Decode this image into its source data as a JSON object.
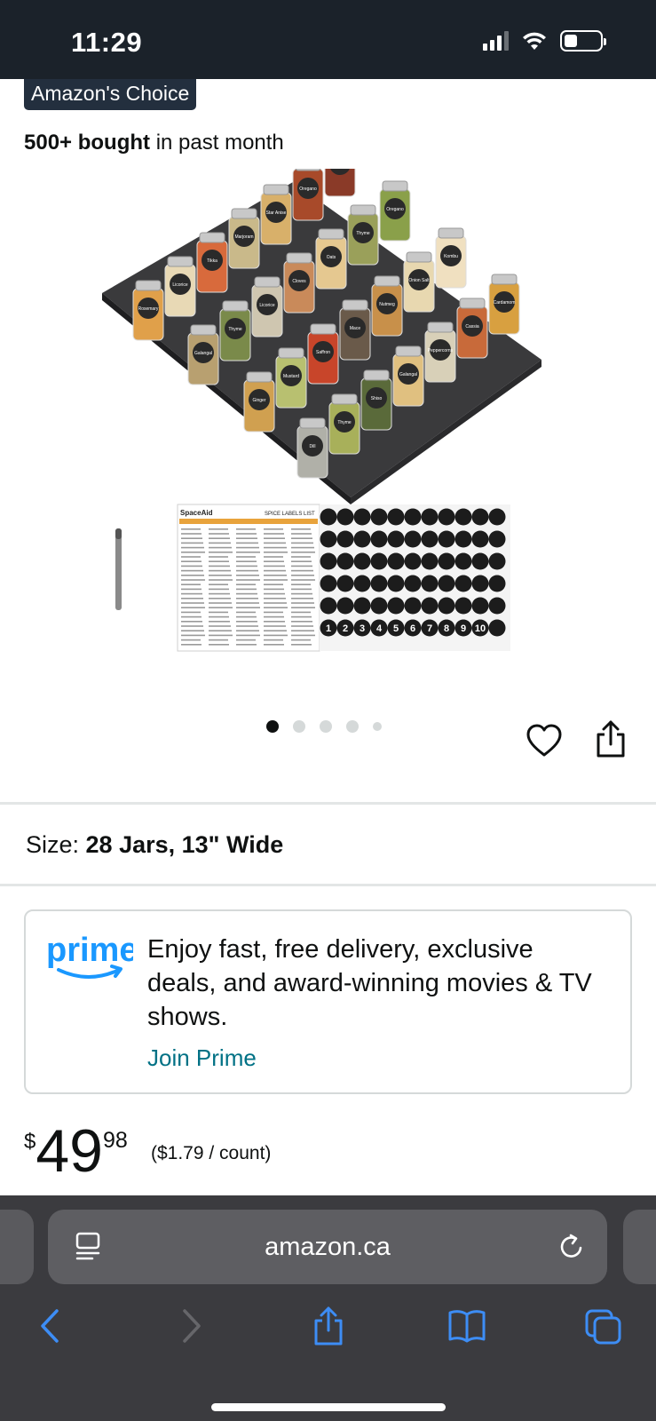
{
  "status_bar": {
    "time": "11:29"
  },
  "badge": {
    "label": "Amazon's Choice"
  },
  "bought": {
    "count": "500+ bought",
    "suffix": " in past month"
  },
  "product_image": {
    "jar_labels": [
      "Rosemary",
      "Licorice",
      "Tikka",
      "Marjoram",
      "Star Anise",
      "Oregano",
      "Tarragon",
      "Galangal",
      "Thyme",
      "Licorice",
      "Cloves",
      "Oats",
      "Thyme",
      "Oregano",
      "Ginger",
      "Mustard",
      "Saffron",
      "Mace",
      "Nutmeg",
      "Onion Salt",
      "Kombu",
      "Dill",
      "Thyme",
      "Shiso",
      "Galangal",
      "Peppercorns",
      "Cassia",
      "Cardamom"
    ],
    "labels_sheet_brand": "SpaceAid",
    "labels_sheet_title": "SPICE LABELS LIST",
    "label_numbers": [
      "1",
      "2",
      "3",
      "4",
      "5",
      "6",
      "7",
      "8",
      "9",
      "10"
    ]
  },
  "carousel": {
    "total": 5,
    "active": 0
  },
  "size": {
    "label": "Size: ",
    "value": "28 Jars, 13\" Wide"
  },
  "prime": {
    "logo": "prime",
    "text": "Enjoy fast, free delivery, exclusive deals, and award-winning movies & TV shows.",
    "link": "Join Prime"
  },
  "price": {
    "symbol": "$",
    "whole": "49",
    "fraction": "98",
    "unit": "($1.79 / count)"
  },
  "browser": {
    "url": "amazon.ca"
  },
  "colors": {
    "status_bar": "#1b222a",
    "badge": "#232f3e",
    "prime_blue": "#1a98ff",
    "link": "#007185",
    "browser_bar": "#3b3b3f",
    "toolbar_icon": "#3d8df5"
  }
}
